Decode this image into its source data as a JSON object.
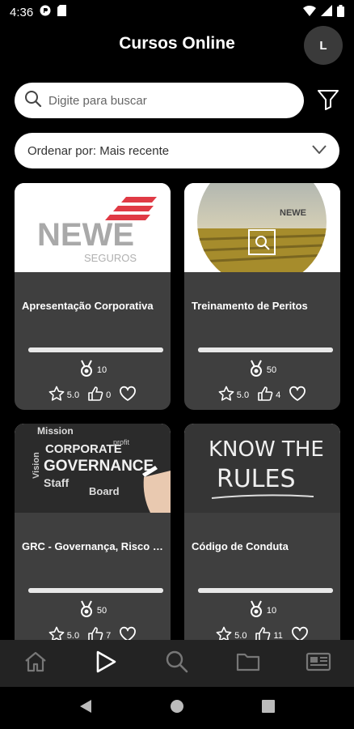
{
  "status_bar": {
    "time": "4:36"
  },
  "header": {
    "title": "Cursos Online",
    "avatar_initial": "L"
  },
  "search": {
    "placeholder": "Digite para buscar"
  },
  "sort": {
    "label": "Ordenar por: Mais recente"
  },
  "courses": [
    {
      "title": "Apresentação Corporativa",
      "points": "10",
      "rating": "5.0",
      "likes": "0",
      "progress": 1.0,
      "image": "newe-seguros-logo",
      "logo_text": "NEWE",
      "logo_sub": "SEGUROS"
    },
    {
      "title": "Treinamento de Peritos",
      "points": "50",
      "rating": "5.0",
      "likes": "4",
      "progress": 1.0,
      "image": "farm-field-photo",
      "logo_text": "NEWE"
    },
    {
      "title": "GRC - Governança, Risco e Compliance",
      "points": "50",
      "rating": "5.0",
      "likes": "7",
      "progress": 1.0,
      "image": "corporate-governance-chalkboard",
      "chalk_words": [
        "Mission",
        "CORPORATE",
        "GOVERNANCE",
        "Staff",
        "Board",
        "Vision",
        "profit"
      ]
    },
    {
      "title": "Código de Conduta",
      "points": "10",
      "rating": "5.0",
      "likes": "11",
      "progress": 1.0,
      "image": "know-the-rules-chalkboard",
      "chalk_words": [
        "KNOW THE",
        "RULES"
      ]
    }
  ],
  "bottom_nav": {
    "items": [
      "home-icon",
      "play-icon",
      "search-icon",
      "folder-icon",
      "news-icon"
    ],
    "active": "play-icon"
  },
  "colors": {
    "background": "#000000",
    "card": "#3f3f3f",
    "nav": "#232323",
    "brand_red": "#e03a45"
  }
}
